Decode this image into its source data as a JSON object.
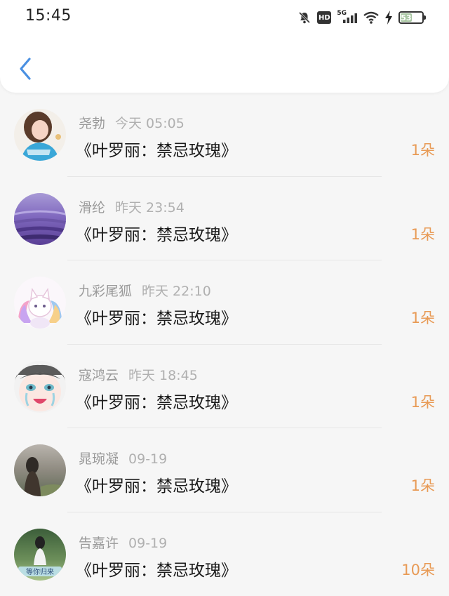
{
  "status_bar": {
    "time": "15:45",
    "network": "5G",
    "hd": "HD",
    "battery": "53",
    "battery_level": 0.53,
    "icons": [
      "mute-icon",
      "hd-icon",
      "signal-5g-icon",
      "wifi-icon",
      "charging-icon",
      "battery-icon"
    ]
  },
  "nav": {
    "back_icon": "chevron-left-icon",
    "accent_color": "#4a90e2"
  },
  "list": {
    "items": [
      {
        "user": "尧勃",
        "date": "今天 05:05",
        "title": "《叶罗丽：禁忌玫瑰》",
        "count": "1朵"
      },
      {
        "user": "滑纶",
        "date": "昨天 23:54",
        "title": "《叶罗丽：禁忌玫瑰》",
        "count": "1朵"
      },
      {
        "user": "九彩尾狐",
        "date": "昨天 22:10",
        "title": "《叶罗丽：禁忌玫瑰》",
        "count": "1朵"
      },
      {
        "user": "寇鸿云",
        "date": "昨天 18:45",
        "title": "《叶罗丽：禁忌玫瑰》",
        "count": "1朵"
      },
      {
        "user": "晁琬凝",
        "date": "09-19",
        "title": "《叶罗丽：禁忌玫瑰》",
        "count": "1朵"
      },
      {
        "user": "告嘉许",
        "date": "09-19",
        "title": "《叶罗丽：禁忌玫瑰》",
        "count": "10朵",
        "avatar_caption": "等你归来"
      }
    ]
  },
  "colors": {
    "count": "#e89a55",
    "title": "#1b1b1b",
    "meta": "#9a9a9a"
  }
}
